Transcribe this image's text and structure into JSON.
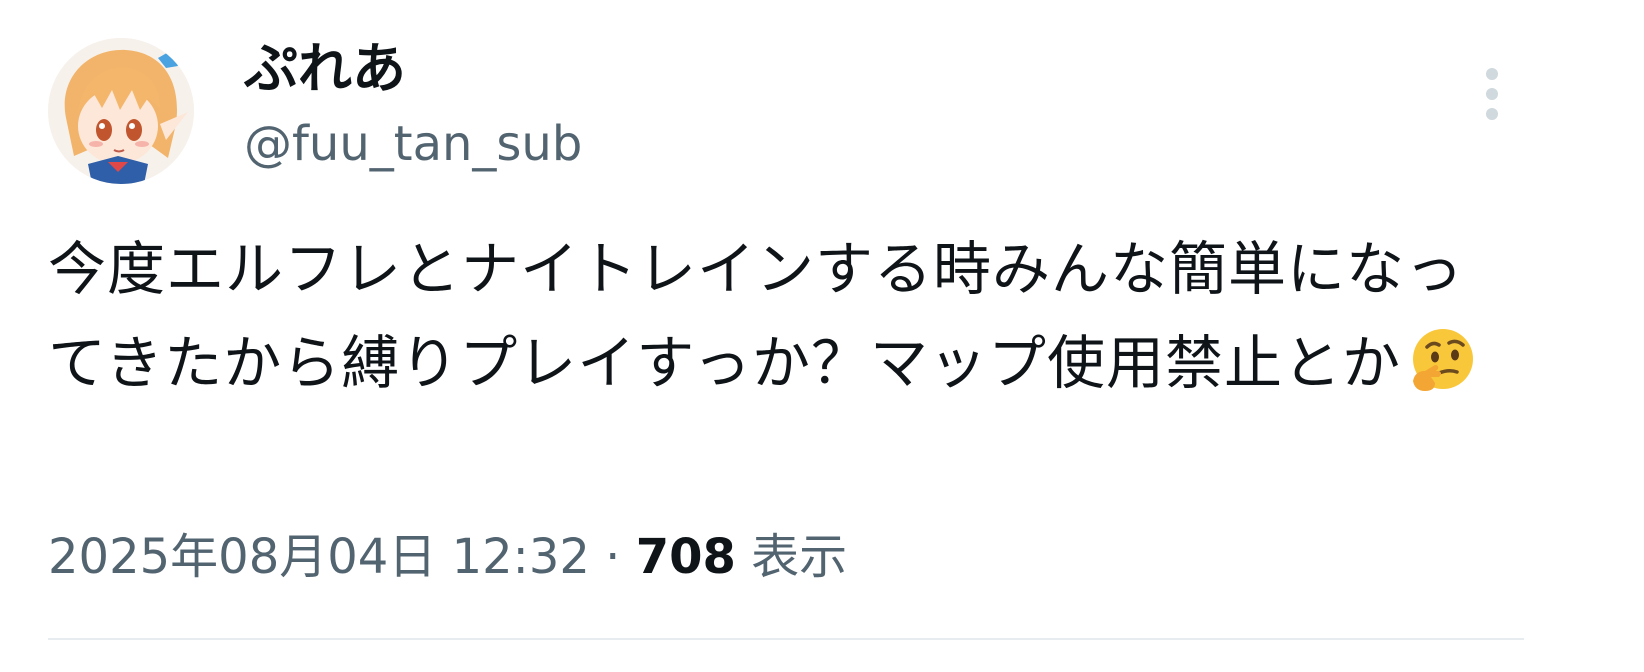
{
  "author": {
    "display_name": "ぷれあ",
    "handle": "@fuu_tan_sub"
  },
  "tweet": {
    "text": "今度エルフレとナイトレインする時みんな簡単になってきたから縛りプレイすっか？マップ使用禁止とか",
    "emoji": "thinking-face"
  },
  "meta": {
    "timestamp": "2025年08月04日 12:32",
    "separator": "·",
    "views_count": "708",
    "views_label": "表示"
  },
  "icons": {
    "more": "more-vertical-icon"
  }
}
